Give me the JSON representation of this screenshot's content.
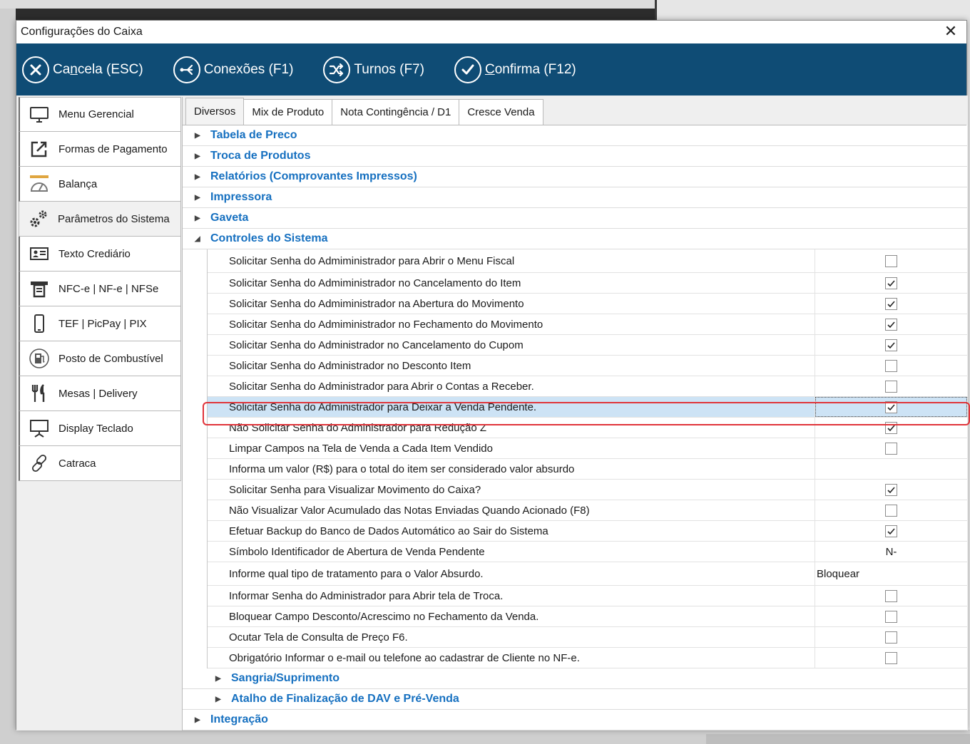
{
  "dialog": {
    "title": "Configurações do Caixa",
    "close_glyph": "✕"
  },
  "toolbar": {
    "cancel": {
      "prefix": "Ca",
      "underline": "n",
      "suffix": "cela (ESC)",
      "icon": "cancel-icon"
    },
    "connections": {
      "label": "Conexões (F1)",
      "icon": "connections-icon"
    },
    "shifts": {
      "label": "Turnos (F7)",
      "icon": "shuffle-icon"
    },
    "confirm": {
      "underline": "C",
      "suffix": "onfirma (F12)",
      "icon": "check-icon"
    }
  },
  "sidebar": {
    "items": [
      {
        "label": "Menu Gerencial",
        "icon": "monitor-icon"
      },
      {
        "label": "Formas de Pagamento",
        "icon": "external-link-icon"
      },
      {
        "label": "Balança",
        "icon": "scale-gauge-icon"
      },
      {
        "label": "Parâmetros do Sistema",
        "icon": "gears-icon"
      },
      {
        "label": "Texto Crediário",
        "icon": "id-card-icon"
      },
      {
        "label": "NFC-e | NF-e | NFSe",
        "icon": "receipt-icon"
      },
      {
        "label": "TEF | PicPay | PIX",
        "icon": "phone-icon"
      },
      {
        "label": "Posto de Combustível",
        "icon": "fuel-pump-icon"
      },
      {
        "label": "Mesas | Delivery",
        "icon": "cutlery-icon"
      },
      {
        "label": "Display Teclado",
        "icon": "display-icon"
      },
      {
        "label": "Catraca",
        "icon": "link-icon"
      }
    ]
  },
  "tabs": [
    "Diversos",
    "Mix de Produto",
    "Nota Contingência / D1",
    "Cresce Venda"
  ],
  "tree": {
    "groups_top": [
      "Tabela de Preco",
      "Troca de Produtos",
      "Relatórios (Comprovantes Impressos)",
      "Impressora",
      "Gaveta"
    ],
    "expanded_group": "Controles do Sistema",
    "rows": [
      {
        "label": "Solicitar Senha do Admiministrador para Abrir o Menu Fiscal",
        "type": "checkbox",
        "checked": false
      },
      {
        "label": "Solicitar Senha do Admiministrador no Cancelamento do Item",
        "type": "checkbox",
        "checked": true
      },
      {
        "label": "Solicitar Senha do Admiministrador na Abertura do Movimento",
        "type": "checkbox",
        "checked": true
      },
      {
        "label": "Solicitar Senha do Admiministrador no Fechamento do Movimento",
        "type": "checkbox",
        "checked": true
      },
      {
        "label": "Solicitar Senha do Administrador no Cancelamento do Cupom",
        "type": "checkbox",
        "checked": true
      },
      {
        "label": "Solicitar Senha do Administrador no Desconto Item",
        "type": "checkbox",
        "checked": false
      },
      {
        "label": "Solicitar Senha do Administrador para Abrir o Contas a Receber.",
        "type": "checkbox",
        "checked": false
      },
      {
        "label": "Solicitar Senha do Administrador para Deixar a Venda Pendente.",
        "type": "checkbox",
        "checked": true,
        "selected": true
      },
      {
        "label": "Não Solicitar Senha do Administrador para Redução Z",
        "type": "checkbox",
        "checked": true
      },
      {
        "label": "Limpar Campos na Tela de Venda a Cada Item Vendido",
        "type": "checkbox",
        "checked": false
      },
      {
        "label": "Informa um valor (R$) para o total do item ser considerado valor absurdo",
        "type": "text",
        "value": ""
      },
      {
        "label": "Solicitar Senha para Visualizar Movimento do Caixa?",
        "type": "checkbox",
        "checked": true
      },
      {
        "label": "Não Visualizar Valor Acumulado das Notas Enviadas Quando Acionado (F8)",
        "type": "checkbox",
        "checked": false
      },
      {
        "label": "Efetuar Backup do Banco de Dados Automático ao Sair do Sistema",
        "type": "checkbox",
        "checked": true
      },
      {
        "label": "Símbolo Identificador de Abertura de Venda Pendente",
        "type": "center-text",
        "value": "N-"
      },
      {
        "label": "Informe qual tipo de tratamento para o Valor Absurdo.",
        "type": "text",
        "value": "Bloquear"
      },
      {
        "label": "Informar Senha do Administrador para Abrir tela de Troca.",
        "type": "checkbox",
        "checked": false
      },
      {
        "label": "Bloquear Campo Desconto/Acrescimo no Fechamento da Venda.",
        "type": "checkbox",
        "checked": false
      },
      {
        "label": "Ocutar Tela de Consulta de Preço F6.",
        "type": "checkbox",
        "checked": false
      },
      {
        "label": "Obrigatório Informar o e-mail ou telefone ao cadastrar de Cliente no NF-e.",
        "type": "checkbox",
        "checked": false
      }
    ],
    "subgroups": [
      "Sangria/Suprimento",
      "Atalho de Finalização de DAV e Pré-Venda"
    ],
    "groups_bottom": [
      "Integração"
    ]
  }
}
